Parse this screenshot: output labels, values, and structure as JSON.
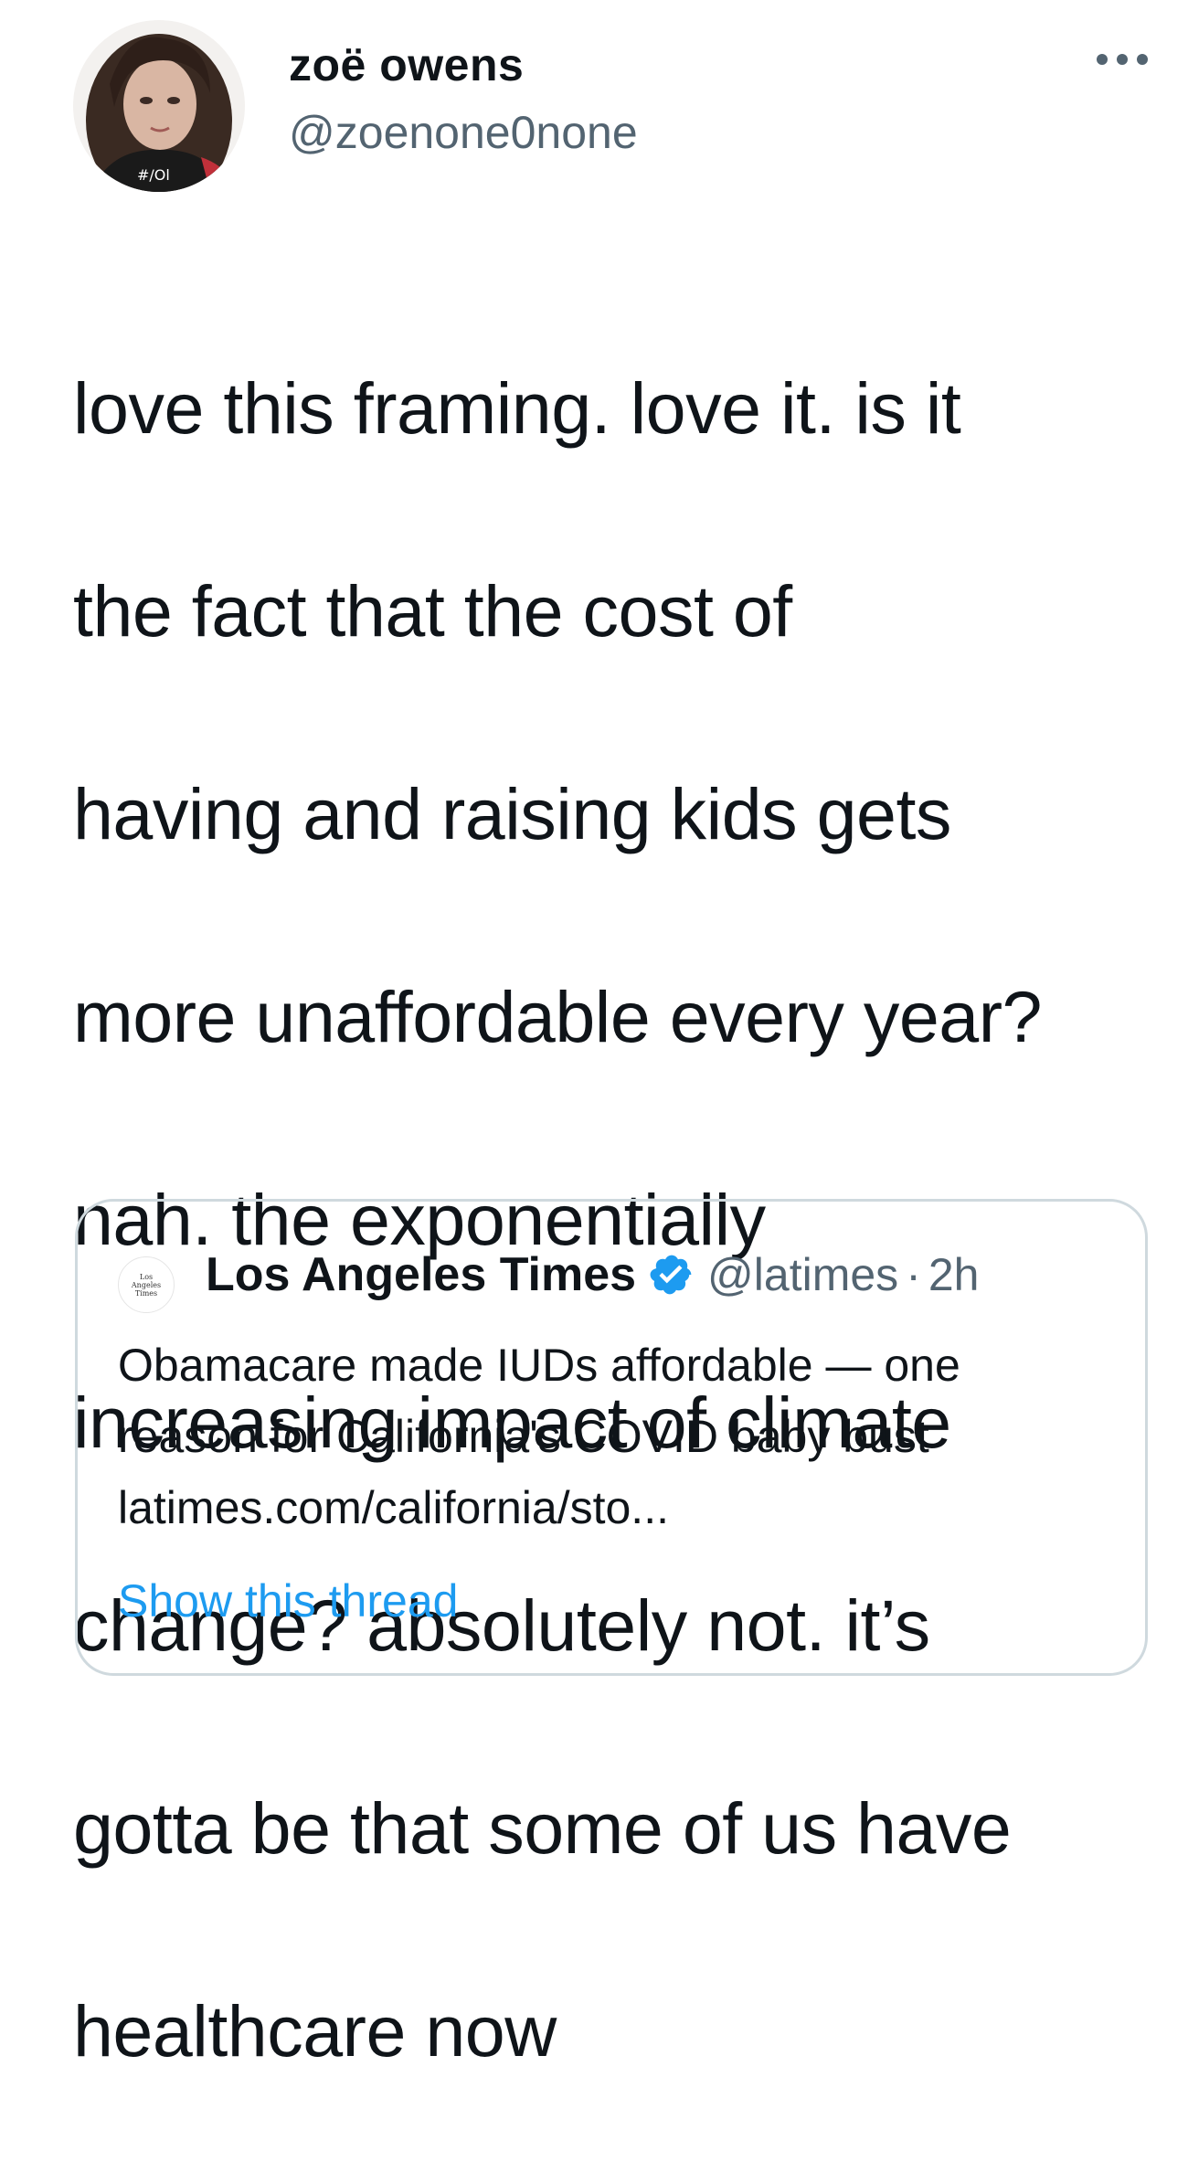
{
  "tweet": {
    "author": {
      "name": "zoë owens",
      "handle": "@zoenone0none",
      "avatar_icon": "profile-photo"
    },
    "more_icon": "more-horizontal-icon",
    "text_lines": [
      "love this framing. love it. is it",
      "the fact that the cost of",
      "having and raising kids gets",
      "more unaffordable every year?",
      "nah. the exponentially",
      "increasing impact of climate",
      "change? absolutely not. it’s",
      "gotta be that some of us have",
      "healthcare now"
    ]
  },
  "quoted_tweet": {
    "logo_text": [
      "Los",
      "Angeles",
      "Times"
    ],
    "author_name": "Los Angeles Times",
    "verified_icon": "verified-badge-icon",
    "handle": "@latimes",
    "separator": "·",
    "time": "2h",
    "text_lines": [
      "Obamacare made IUDs affordable — one",
      "reason for California's COVID baby bust",
      "latimes.com/california/sto..."
    ],
    "show_thread_label": "Show this thread"
  },
  "colors": {
    "text_primary": "#0f1419",
    "text_secondary": "#536471",
    "link": "#1d9bf0",
    "verified": "#1d9bf0",
    "border": "#cfd9de"
  }
}
